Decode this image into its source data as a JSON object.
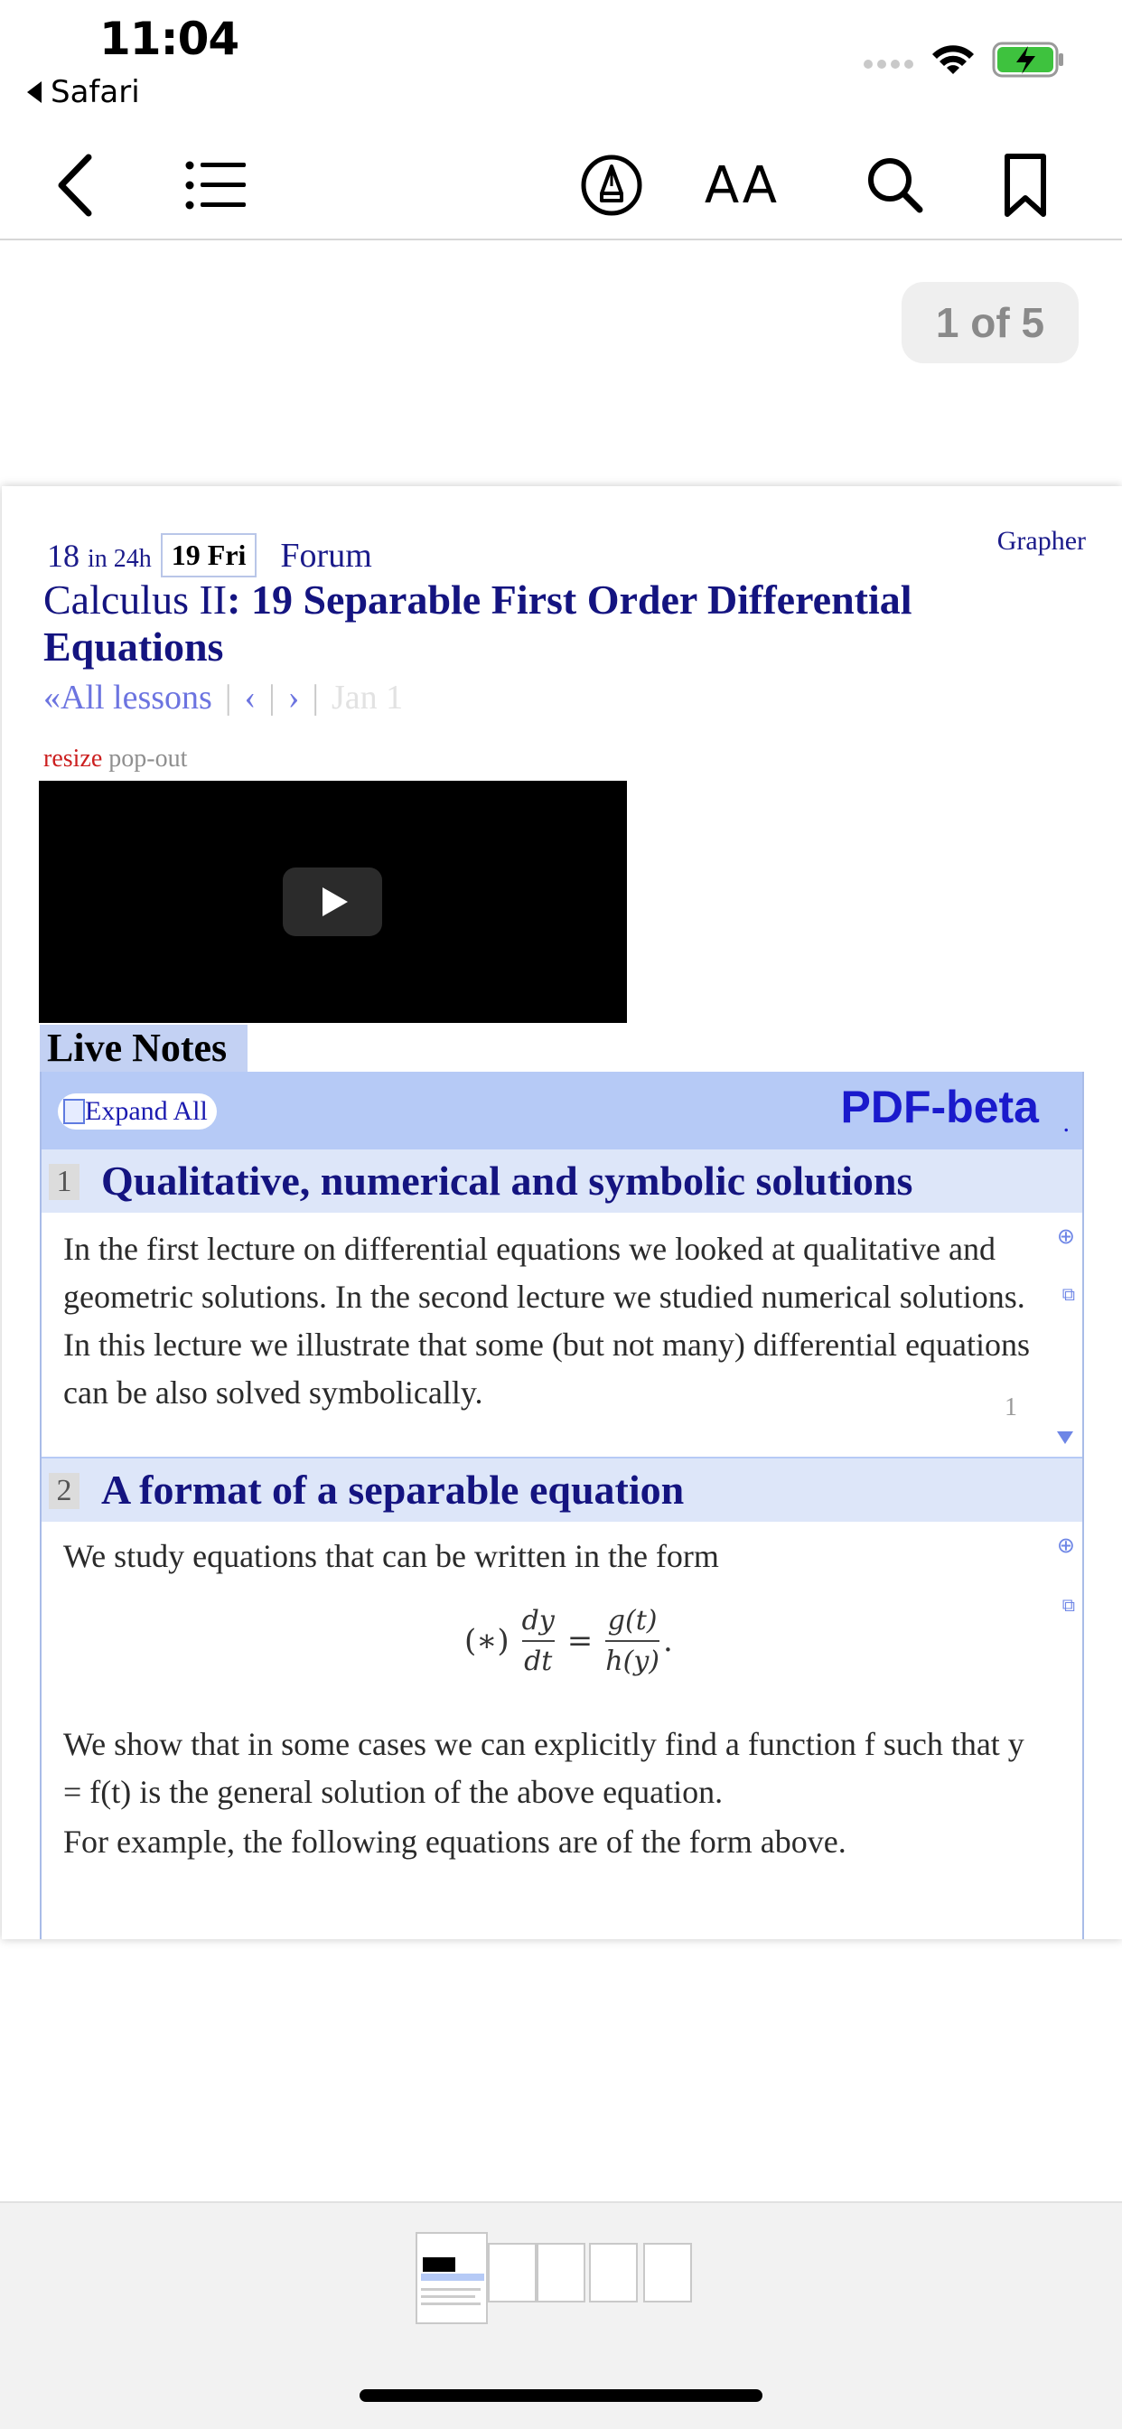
{
  "status_bar": {
    "time": "11:04",
    "back_app": "Safari"
  },
  "toolbar": {
    "back_icon": "chevron-left-icon",
    "contents_icon": "list-icon",
    "markup_icon": "markup-pen-icon",
    "text_size_label": "AA",
    "search_icon": "search-icon",
    "bookmark_icon": "bookmark-icon"
  },
  "page_counter": "1 of 5",
  "document": {
    "nav": {
      "count": "18",
      "count_suffix": "in 24h",
      "day": "19 Fri",
      "forum": "Forum",
      "grapher": "Grapher"
    },
    "title_prefix": "Calculus II",
    "title_main": ": 19 Separable First Order Differential Equations",
    "lessons": {
      "all": "«All lessons",
      "prev": "‹",
      "next": "›",
      "faint": "Jan 1"
    },
    "resize": "resize",
    "popout": "pop-out",
    "live_notes": "Live Notes",
    "expand_all": "Expand All",
    "pdf_beta": "PDF-beta",
    "sections": [
      {
        "num": "1",
        "title": "Qualitative, numerical and symbolic solutions",
        "body": "In the first lecture on differential equations we looked at qualitative and geometric solutions. In the second lecture we studied numerical solutions. In this lecture we illustrate that some (but not many) differential equations can be also solved symbolically.",
        "footnote": "1"
      },
      {
        "num": "2",
        "title": "A format of a separable equation",
        "intro": "We study equations that can be written in the form",
        "equation": {
          "label": "(∗)",
          "lhs_num": "dy",
          "lhs_den": "dt",
          "rhs_num": "g(t)",
          "rhs_den": "h(y)"
        },
        "para1": "We show that in some cases we can explicitly find a function f such that y = f(t) is the general solution of the above equation.",
        "para2": "For example, the following equations are of the form above."
      }
    ]
  },
  "colors": {
    "accent": "#1a1a8a",
    "notes_header": "#b6caf6",
    "section_header": "#dde6f9",
    "resize": "#cc1f1f"
  }
}
